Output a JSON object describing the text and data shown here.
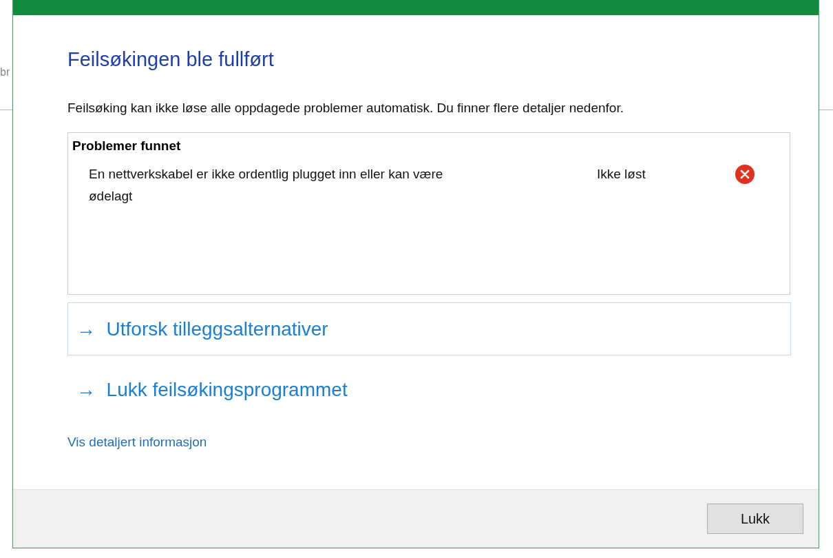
{
  "background_text": "br",
  "dialog": {
    "title": "Feilsøkingen ble fullført",
    "description": "Feilsøking kan ikke løse alle oppdagede problemer automatisk. Du finner flere detaljer nedenfor.",
    "problems": {
      "heading": "Problemer funnet",
      "items": [
        {
          "text": "En nettverkskabel er ikke ordentlig plugget inn eller kan være ødelagt",
          "status": "Ikke løst",
          "kind": "error"
        }
      ]
    },
    "options": [
      {
        "arrow": "→",
        "label": "Utforsk tilleggsalternativer",
        "hovered": true
      },
      {
        "arrow": "→",
        "label": "Lukk feilsøkingsprogrammet",
        "hovered": false
      }
    ],
    "details_link": "Vis detaljert informasjon",
    "buttons": [
      "Lukk"
    ]
  }
}
